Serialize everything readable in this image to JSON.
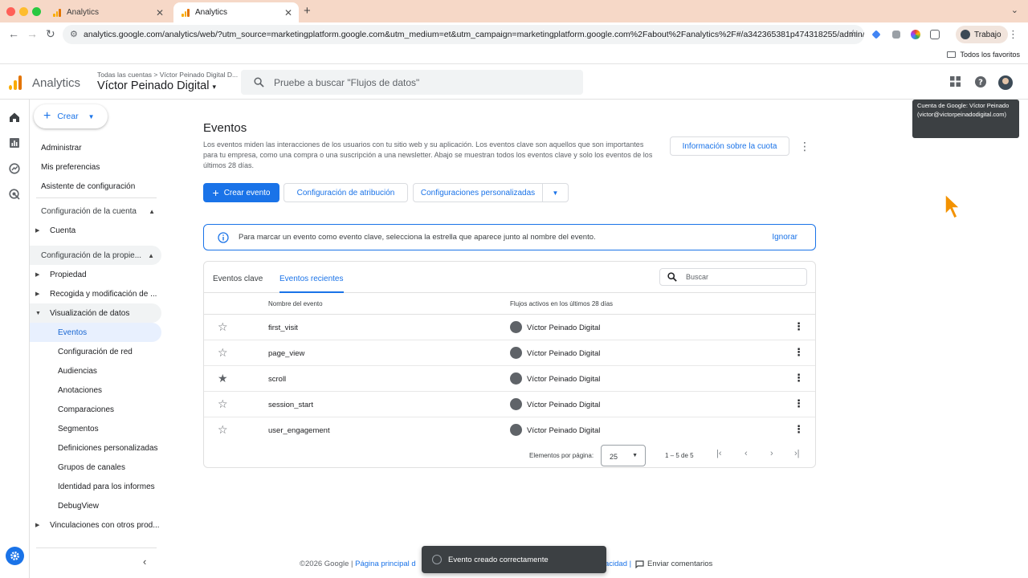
{
  "browser": {
    "tabs": [
      {
        "title": "Analytics"
      },
      {
        "title": "Analytics"
      }
    ],
    "url": "analytics.google.com/analytics/web/?utm_source=marketingplatform.google.com&utm_medium=et&utm_campaign=marketingplatform.google.com%2Fabout%2Fanalytics%2F#/a342365381p474318255/admin/e...",
    "profile": "Trabajo",
    "bookmarks_folder": "Todos los favoritos"
  },
  "header": {
    "app_name": "Analytics",
    "breadcrumb": "Todas las cuentas > Víctor Peinado Digital D...",
    "property": "Víctor Peinado Digital",
    "search_placeholder": "Pruebe a buscar \"Flujos de datos\""
  },
  "tooltip": "Cuenta de Google: Víctor Peinado (victor@victorpeinadodigital.com)",
  "sidebar": {
    "create": "Crear",
    "top_items": [
      "Administrar",
      "Mis preferencias",
      "Asistente de configuración"
    ],
    "account_section": "Configuración de la cuenta",
    "account_item": "Cuenta",
    "property_section": "Configuración de la propie...",
    "property_items": [
      "Propiedad",
      "Recogida y modificación de ...",
      "Visualización de datos"
    ],
    "data_display_items": [
      "Eventos",
      "Configuración de red",
      "Audiencias",
      "Anotaciones",
      "Comparaciones",
      "Segmentos",
      "Definiciones personalizadas",
      "Grupos de canales",
      "Identidad para los informes",
      "DebugView"
    ],
    "links_item": "Vinculaciones con otros prod..."
  },
  "main": {
    "title": "Eventos",
    "description": "Los eventos miden las interacciones de los usuarios con tu sitio web y su aplicación. Los eventos clave son aquellos que son importantes para tu empresa, como una compra o una suscripción a una newsletter. Abajo se muestran todos los eventos clave y solo los eventos de los últimos 28 días.",
    "quota_button": "Información sobre la cuota",
    "create_event": "Crear evento",
    "attribution": "Configuración de atribución",
    "custom_configs": "Configuraciones personalizadas",
    "banner_text": "Para marcar un evento como evento clave, selecciona la estrella que aparece junto al nombre del evento.",
    "banner_dismiss": "Ignorar",
    "tabs": [
      "Eventos clave",
      "Eventos recientes"
    ],
    "table_search": "Buscar",
    "columns": [
      "Nombre del evento",
      "Flujos activos en los últimos 28 días"
    ],
    "rows": [
      {
        "name": "first_visit",
        "stream": "Víctor Peinado Digital",
        "starred": false
      },
      {
        "name": "page_view",
        "stream": "Víctor Peinado Digital",
        "starred": false
      },
      {
        "name": "scroll",
        "stream": "Víctor Peinado Digital",
        "starred": true
      },
      {
        "name": "session_start",
        "stream": "Víctor Peinado Digital",
        "starred": false
      },
      {
        "name": "user_engagement",
        "stream": "Víctor Peinado Digital",
        "starred": false
      }
    ],
    "per_page_label": "Elementos por página:",
    "per_page_value": "25",
    "range": "1 – 5 de 5"
  },
  "footer": {
    "copyright": "©2026 Google |",
    "home_link": "Página principal d",
    "privacy_tail": "acidad |",
    "feedback": "Enviar comentarios"
  },
  "snackbar": "Evento creado correctamente",
  "colors": {
    "accent": "#1a73e8",
    "ga_yellow": "#f9ab00",
    "ga_orange": "#e37400"
  }
}
